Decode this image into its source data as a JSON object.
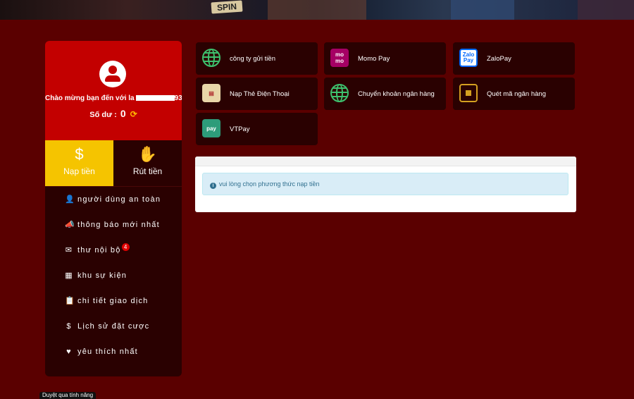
{
  "banner": {
    "spin_text": "SPIN"
  },
  "profile": {
    "welcome_text": "Chào mừng bạn đến với",
    "user_partial": "la",
    "user_suffix": "93",
    "balance_label": "Số dư :",
    "balance_value": "0"
  },
  "actions": [
    {
      "label": "Nạp tiền",
      "icon": "dollar-icon",
      "active": true
    },
    {
      "label": "Rút tiền",
      "icon": "withdraw-hand-icon",
      "active": false
    }
  ],
  "menu": [
    {
      "label": "người dùng an toàn",
      "icon": "user-lock-icon",
      "glyph": "👤"
    },
    {
      "label": "thông báo mới nhất",
      "icon": "megaphone-icon",
      "glyph": "📣"
    },
    {
      "label": "thư nội bộ",
      "icon": "envelope-icon",
      "glyph": "✉",
      "badge": "4"
    },
    {
      "label": "khu sự kiện",
      "icon": "calendar-icon",
      "glyph": "▦"
    },
    {
      "label": "chi tiết giao dịch",
      "icon": "clipboard-icon",
      "glyph": "📋"
    },
    {
      "label": "Lịch sử đặt cược",
      "icon": "dollar-circle-icon",
      "glyph": "$"
    },
    {
      "label": "yêu thích nhất",
      "icon": "heart-icon",
      "glyph": "♥"
    }
  ],
  "payment_methods": [
    {
      "label": "công ty gửi tiền",
      "icon": "globe-icon"
    },
    {
      "label": "Momo Pay",
      "icon": "momo-icon",
      "icon_text": "mo mo"
    },
    {
      "label": "ZaloPay",
      "icon": "zalopay-icon",
      "icon_text": "Zalo Pay"
    },
    {
      "label": "Nạp Thẻ Điện Thoại",
      "icon": "phone-card-icon"
    },
    {
      "label": "Chuyển khoản ngân hàng",
      "icon": "globe-icon"
    },
    {
      "label": "Quét mã ngân hàng",
      "icon": "qr-code-icon"
    },
    {
      "label": "VTPay",
      "icon": "vtpay-icon",
      "icon_text": "pay"
    }
  ],
  "alert": {
    "text": "vui lòng chọn phương thức nạp tiền"
  },
  "bottom_tag": {
    "text": "Duyệt qua tính năng"
  },
  "colors": {
    "page_bg": "#5a0000",
    "panel_bg": "#2a0101",
    "profile_bg": "#c30000",
    "active_tab": "#f5c400",
    "badge": "#e00000"
  }
}
